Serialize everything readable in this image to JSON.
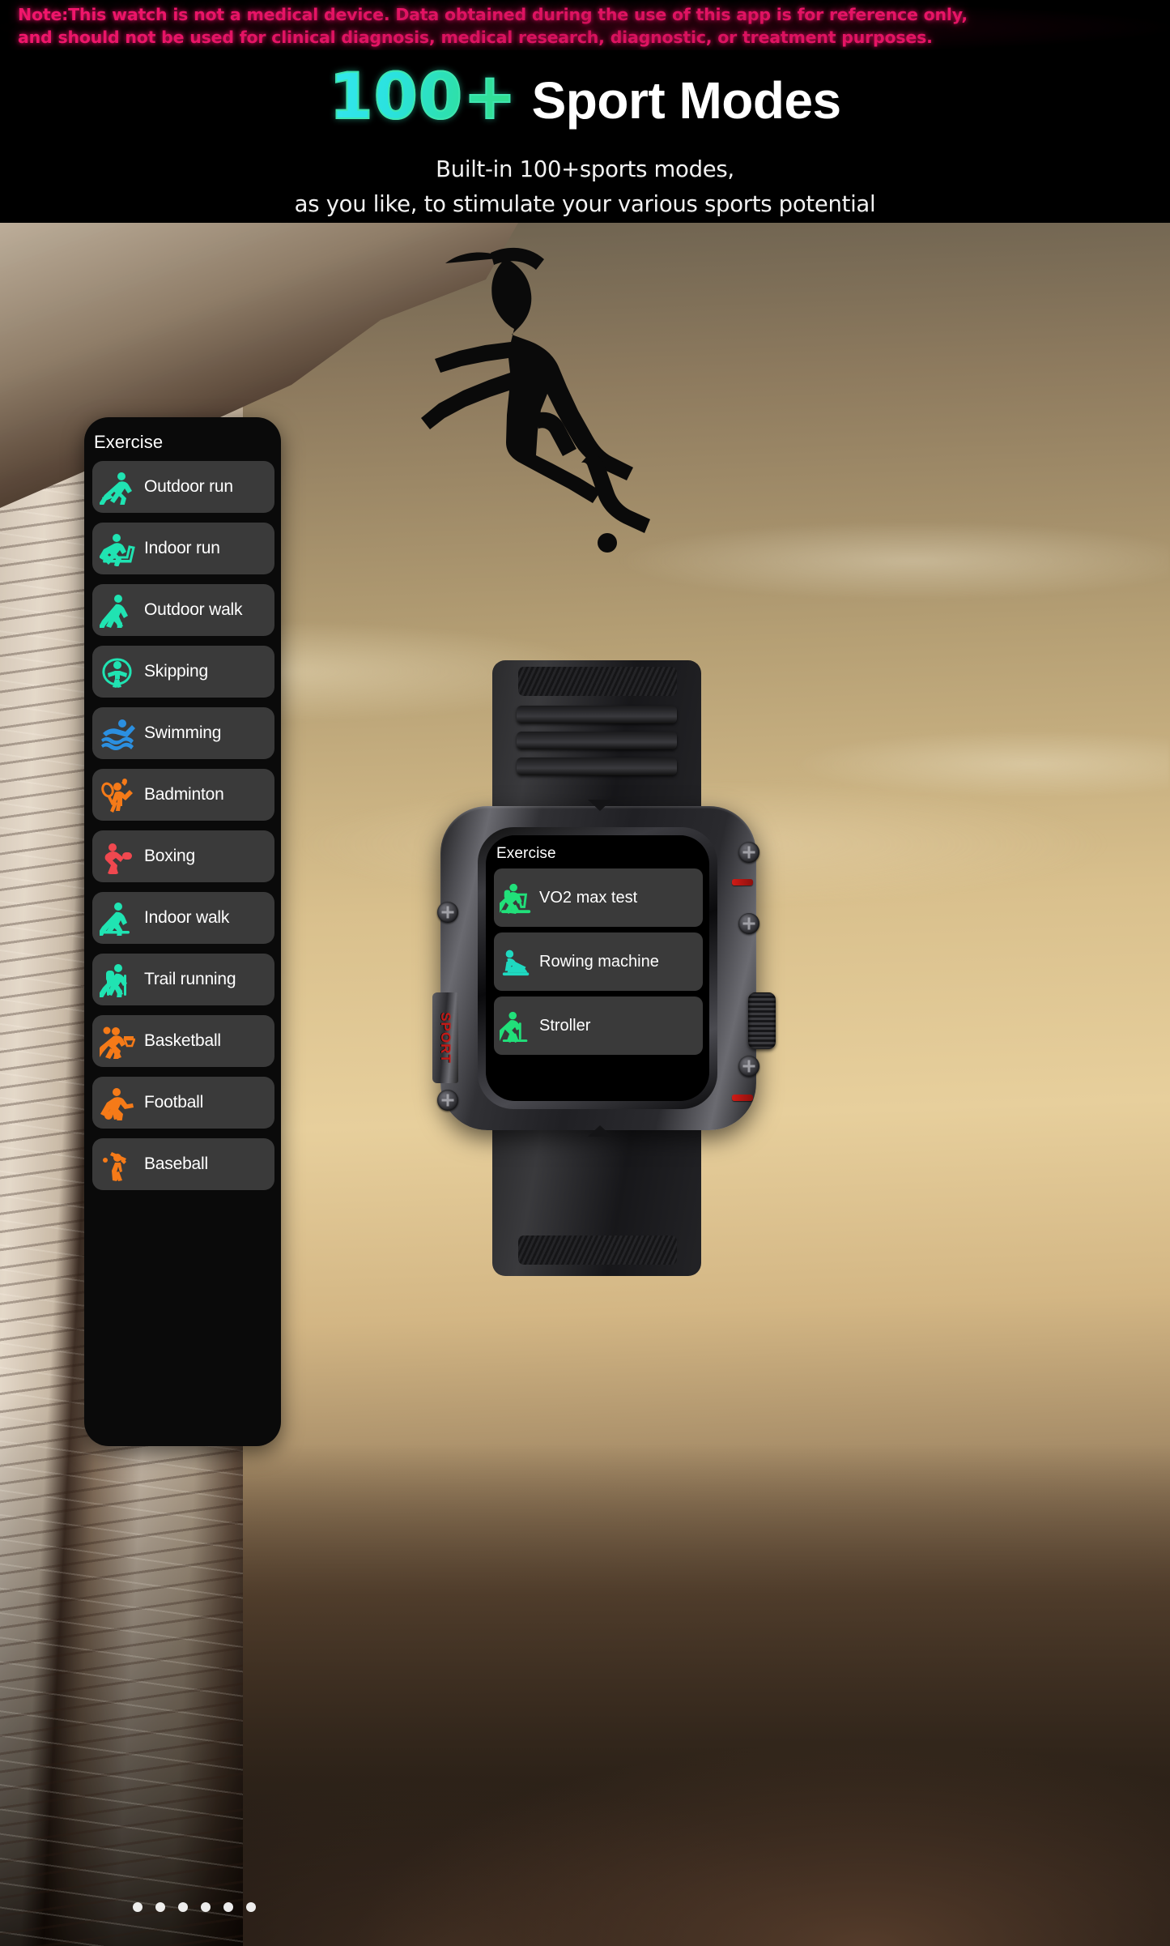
{
  "disclaimer": {
    "line1": "Note:This watch is not a medical device. Data obtained during the use of this app is for reference only,",
    "line2": "and should not be used for clinical diagnosis, medical research, diagnostic, or treatment purposes.",
    "color": "#f0166b"
  },
  "header": {
    "title_highlight": "100+",
    "title_rest": "Sport Modes",
    "subtitle_line1": "Built-in 100+sports modes,",
    "subtitle_line2": "as you like, to stimulate your various sports potential",
    "highlight_color_start": "#35e7ef",
    "highlight_color_end": "#35e08b"
  },
  "phone_list": {
    "title": "Exercise",
    "items": [
      {
        "label": "Outdoor run",
        "icon": "outdoor-run-icon",
        "color": "#20e3b2"
      },
      {
        "label": "Indoor run",
        "icon": "indoor-run-icon",
        "color": "#20e3b2"
      },
      {
        "label": "Outdoor walk",
        "icon": "outdoor-walk-icon",
        "color": "#20e3b2"
      },
      {
        "label": "Skipping",
        "icon": "skipping-icon",
        "color": "#20e3b2"
      },
      {
        "label": "Swimming",
        "icon": "swimming-icon",
        "color": "#2b8fe0"
      },
      {
        "label": "Badminton",
        "icon": "badminton-icon",
        "color": "#f57a18"
      },
      {
        "label": "Boxing",
        "icon": "boxing-icon",
        "color": "#f0484f"
      },
      {
        "label": "Indoor walk",
        "icon": "indoor-walk-icon",
        "color": "#20e3b2"
      },
      {
        "label": "Trail running",
        "icon": "trail-running-icon",
        "color": "#20e3b2"
      },
      {
        "label": "Basketball",
        "icon": "basketball-icon",
        "color": "#f57a18"
      },
      {
        "label": "Football",
        "icon": "football-icon",
        "color": "#f57a18"
      },
      {
        "label": "Baseball",
        "icon": "baseball-icon",
        "color": "#f57a18"
      }
    ]
  },
  "watch": {
    "side_button_label": "SPORT",
    "side_button_color": "#c21a17",
    "screen": {
      "title": "Exercise",
      "items": [
        {
          "label": "VO2 max test",
          "icon": "vo2-max-test-icon",
          "color": "#21e07a"
        },
        {
          "label": "Rowing machine",
          "icon": "rowing-machine-icon",
          "color": "#1fd9c0"
        },
        {
          "label": "Stroller",
          "icon": "stroller-icon",
          "color": "#21e07a"
        }
      ]
    }
  },
  "pagination": {
    "count": 6,
    "active_index": 0
  }
}
